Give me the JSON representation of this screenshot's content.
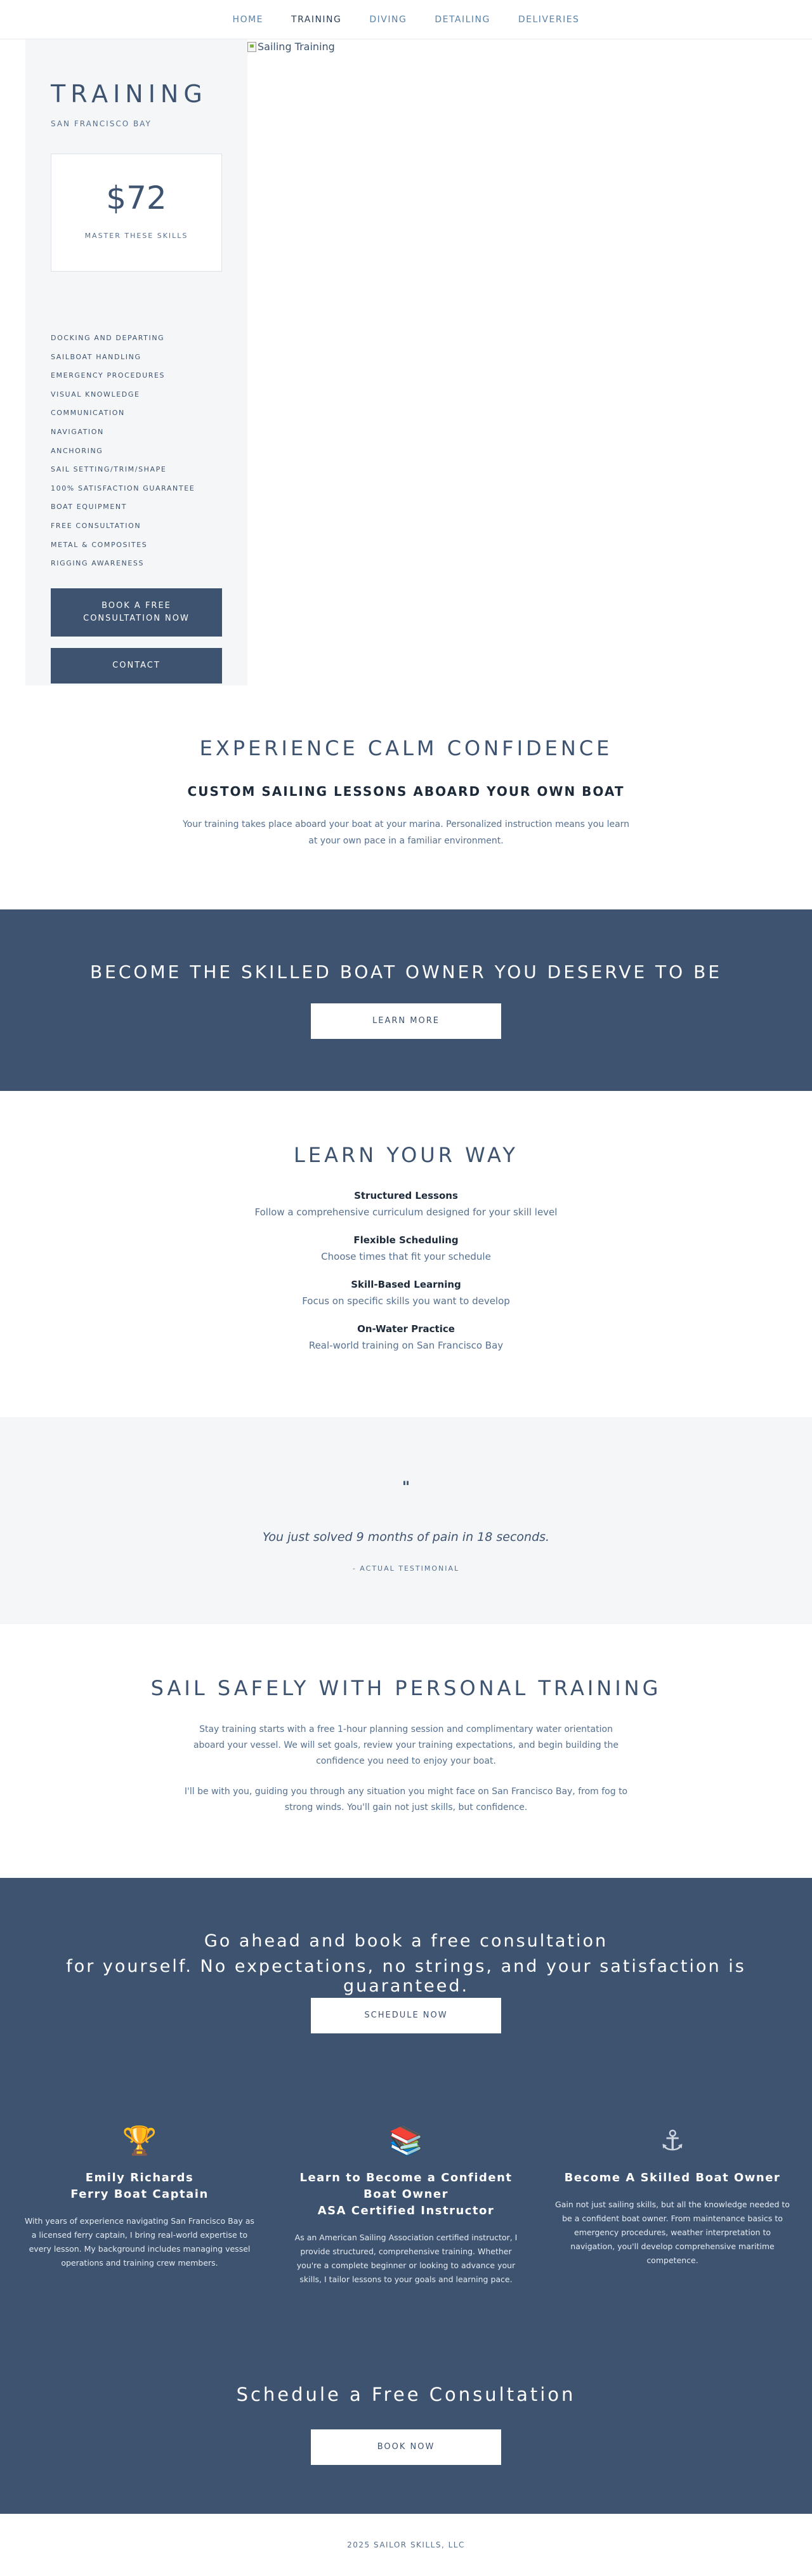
{
  "nav": {
    "items": [
      "HOME",
      "TRAINING",
      "DIVING",
      "DETAILING",
      "DELIVERIES"
    ],
    "active": "TRAINING"
  },
  "hero": {
    "title": "TRAINING",
    "subtitle": "SAN FRANCISCO BAY",
    "price": "$72",
    "price_caption": "MASTER THESE SKILLS",
    "skills": [
      "DOCKING AND DEPARTING",
      "SAILBOAT HANDLING",
      "EMERGENCY PROCEDURES",
      "VISUAL KNOWLEDGE",
      "COMMUNICATION",
      "NAVIGATION",
      "ANCHORING",
      "SAIL SETTING/TRIM/SHAPE",
      "100% SATISFACTION GUARANTEE",
      "BOAT EQUIPMENT",
      "FREE CONSULTATION",
      "METAL & COMPOSITES",
      "RIGGING AWARENESS"
    ],
    "book_button": "BOOK A FREE CONSULTATION NOW",
    "contact_button": "CONTACT",
    "image_alt": "Sailing Training"
  },
  "calm": {
    "title": "EXPERIENCE CALM CONFIDENCE",
    "subtitle": "CUSTOM SAILING LESSONS ABOARD YOUR OWN BOAT",
    "body": "Your training takes place aboard your boat at your marina. Personalized instruction means you learn at your own pace in a familiar environment."
  },
  "band": {
    "title": "BECOME THE SKILLED BOAT OWNER YOU DESERVE TO BE",
    "button": "LEARN MORE"
  },
  "learn": {
    "title": "LEARN YOUR WAY",
    "features": [
      {
        "title": "Structured Lessons",
        "desc": "Follow a comprehensive curriculum designed for your skill level"
      },
      {
        "title": "Flexible Scheduling",
        "desc": "Choose times that fit your schedule"
      },
      {
        "title": "Skill-Based Learning",
        "desc": "Focus on specific skills you want to develop"
      },
      {
        "title": "On-Water Practice",
        "desc": "Real-world training on San Francisco Bay"
      }
    ]
  },
  "testimonial": {
    "mark": "\"",
    "quote": "You just solved 9 months of pain in 18 seconds.",
    "cite": "- ACTUAL TESTIMONIAL"
  },
  "safe": {
    "title": "SAIL SAFELY WITH PERSONAL TRAINING",
    "p1": "Stay training starts with a free 1-hour planning session and complimentary water orientation aboard your vessel. We will set goals, review your training expectations, and begin building the confidence you need to enjoy your boat.",
    "p2": "I'll be with you, guiding you through any situation you might face on San Francisco Bay, from fog to strong winds. You'll gain not just skills, but confidence."
  },
  "cta": {
    "line1": "Go ahead and book a free consultation",
    "line2": "for yourself. No expectations, no strings, and your satisfaction is guaranteed.",
    "button": "SCHEDULE NOW"
  },
  "columns": [
    {
      "icon": "trophy-icon",
      "title1": "Emily Richards",
      "title2": "Ferry Boat Captain",
      "body": "With years of experience navigating San Francisco Bay as a licensed ferry captain, I bring real-world expertise to every lesson. My background includes managing vessel operations and training crew members."
    },
    {
      "icon": "books-icon",
      "title1": "Learn to Become a Confident Boat Owner",
      "title2": "ASA Certified Instructor",
      "body": "As an American Sailing Association certified instructor, I provide structured, comprehensive training. Whether you're a complete beginner or looking to advance your skills, I tailor lessons to your goals and learning pace."
    },
    {
      "icon": "anchor-icon",
      "title1": "Become A Skilled Boat Owner",
      "title2": "",
      "body": "Gain not just sailing skills, but all the knowledge needed to be a confident boat owner. From maintenance basics to emergency procedures, weather interpretation to navigation, you'll develop comprehensive maritime competence."
    }
  ],
  "schedule": {
    "title": "Schedule a Free Consultation",
    "button": "BOOK NOW"
  },
  "footer": {
    "text": "2025 SAILOR SKILLS, LLC"
  },
  "colors": {
    "primary": "#3d5370",
    "nav_link": "#5a82a8",
    "panel_bg": "#f5f6f8"
  }
}
